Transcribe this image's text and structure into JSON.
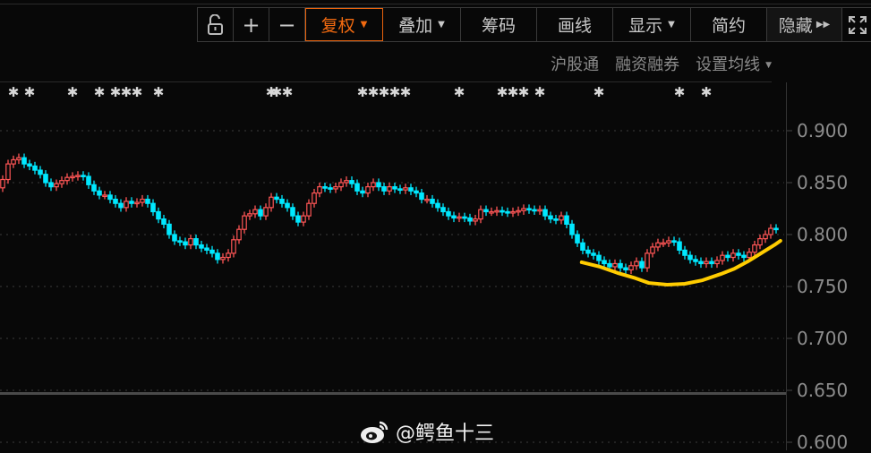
{
  "toolbar": {
    "lock_icon": "unlock-icon",
    "zoom_in": "+",
    "zoom_out": "−",
    "fuquan": "复权",
    "diejia": "叠加",
    "chouma": "筹码",
    "huaxian": "画线",
    "xianshi": "显示",
    "jianyue": "简约",
    "yincang": "隐藏",
    "fullscreen_icon": "fullscreen-icon"
  },
  "subbar": {
    "hugutong": "沪股通",
    "rongzi": "融资融券",
    "junxian": "设置均线"
  },
  "colors": {
    "up": "#ff5656",
    "down": "#00e8ff",
    "accent": "#f26a10",
    "annotation": "#ffcc00",
    "bg": "#080808"
  },
  "watermark": {
    "icon": "weibo-icon",
    "text": "@鳄鱼十三"
  },
  "chart_data": {
    "type": "candlestick",
    "y_ticks": [
      "0.900",
      "0.850",
      "0.800",
      "0.750",
      "0.700",
      "0.650",
      "0.600"
    ],
    "ylim": [
      0.6,
      0.9
    ],
    "first_open": 0.845,
    "close": [
      0.853,
      0.868,
      0.872,
      0.874,
      0.868,
      0.866,
      0.862,
      0.858,
      0.85,
      0.846,
      0.849,
      0.852,
      0.855,
      0.856,
      0.857,
      0.856,
      0.848,
      0.842,
      0.838,
      0.838,
      0.834,
      0.83,
      0.826,
      0.832,
      0.83,
      0.831,
      0.834,
      0.83,
      0.822,
      0.815,
      0.81,
      0.8,
      0.794,
      0.793,
      0.79,
      0.796,
      0.79,
      0.787,
      0.785,
      0.782,
      0.776,
      0.778,
      0.782,
      0.795,
      0.805,
      0.818,
      0.82,
      0.824,
      0.818,
      0.826,
      0.836,
      0.834,
      0.83,
      0.826,
      0.818,
      0.812,
      0.818,
      0.83,
      0.84,
      0.846,
      0.845,
      0.844,
      0.846,
      0.85,
      0.852,
      0.849,
      0.842,
      0.84,
      0.846,
      0.85,
      0.846,
      0.842,
      0.846,
      0.844,
      0.843,
      0.845,
      0.842,
      0.84,
      0.834,
      0.834,
      0.83,
      0.826,
      0.822,
      0.818,
      0.816,
      0.817,
      0.816,
      0.813,
      0.815,
      0.824,
      0.822,
      0.822,
      0.823,
      0.822,
      0.821,
      0.822,
      0.823,
      0.825,
      0.824,
      0.823,
      0.824,
      0.818,
      0.815,
      0.814,
      0.818,
      0.81,
      0.8,
      0.792,
      0.785,
      0.782,
      0.78,
      0.775,
      0.772,
      0.769,
      0.772,
      0.768,
      0.766,
      0.77,
      0.774,
      0.768,
      0.782,
      0.788,
      0.792,
      0.792,
      0.794,
      0.793,
      0.785,
      0.78,
      0.776,
      0.774,
      0.772,
      0.774,
      0.772,
      0.775,
      0.78,
      0.778,
      0.782,
      0.78,
      0.778,
      0.783,
      0.79,
      0.796,
      0.8,
      0.806,
      0.805
    ],
    "annotation_curve": [
      [
        107.8,
        0.7733
      ],
      [
        111.2,
        0.769
      ],
      [
        114.5,
        0.763
      ],
      [
        117.8,
        0.758
      ],
      [
        120.3,
        0.7534
      ],
      [
        123.7,
        0.7517
      ],
      [
        127,
        0.7526
      ],
      [
        130.3,
        0.756
      ],
      [
        133.7,
        0.762
      ],
      [
        136.2,
        0.767
      ],
      [
        138.7,
        0.774
      ],
      [
        141.2,
        0.782
      ],
      [
        143.7,
        0.79
      ],
      [
        144.8,
        0.794
      ]
    ],
    "marker_symbol": "✱",
    "marker_candles": [
      2,
      5,
      13,
      18,
      21,
      23,
      25,
      29,
      50,
      51,
      53,
      67,
      69,
      71,
      73,
      75,
      85,
      93,
      95,
      97,
      100,
      111,
      126,
      131
    ]
  }
}
